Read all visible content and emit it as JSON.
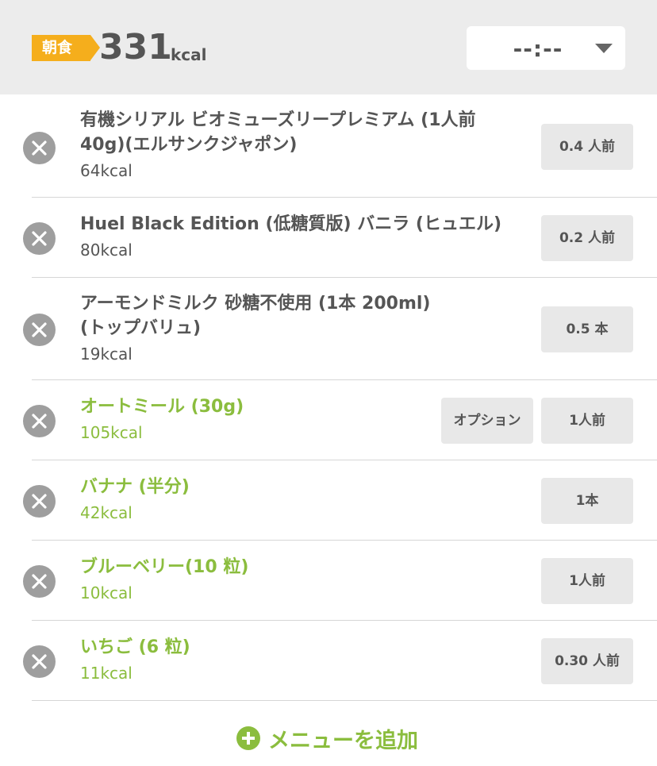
{
  "header": {
    "meal_label": "朝食",
    "total_kcal": "331",
    "kcal_unit": "kcal",
    "time_value": "--:--"
  },
  "items": [
    {
      "name_line1": "有機シリアル ビオミューズリープレミアム (1人前",
      "name_line2": "40g)(エルサンクジャポン)",
      "kcal": "64kcal",
      "qty": "0.4 人前",
      "registered": true
    },
    {
      "name_line1": "Huel Black Edition (低糖質版) バニラ (ヒュエル)",
      "kcal": "80kcal",
      "qty": "0.2 人前",
      "registered": true
    },
    {
      "name_line1": "アーモンドミルク 砂糖不使用 (1本 200ml)",
      "name_line2": "(トップバリュ)",
      "kcal": "19kcal",
      "qty": "0.5 本",
      "registered": true
    },
    {
      "name_line1": "オートミール (30g)",
      "kcal": "105kcal",
      "qty": "1人前",
      "option": "オプション",
      "registered": false
    },
    {
      "name_line1": "バナナ (半分)",
      "kcal": "42kcal",
      "qty": "1本",
      "registered": false
    },
    {
      "name_line1": "ブルーベリー(10 粒)",
      "kcal": "10kcal",
      "qty": "1人前",
      "registered": false
    },
    {
      "name_line1": "いちご (6 粒)",
      "kcal": "11kcal",
      "qty": "0.30 人前",
      "registered": false
    }
  ],
  "add_menu_label": "メニューを追加",
  "colors": {
    "accent_green": "#8bbd3e",
    "meal_tag": "#f5ae1c",
    "header_bg": "#ececec",
    "remove_icon": "#9e9e9e"
  }
}
